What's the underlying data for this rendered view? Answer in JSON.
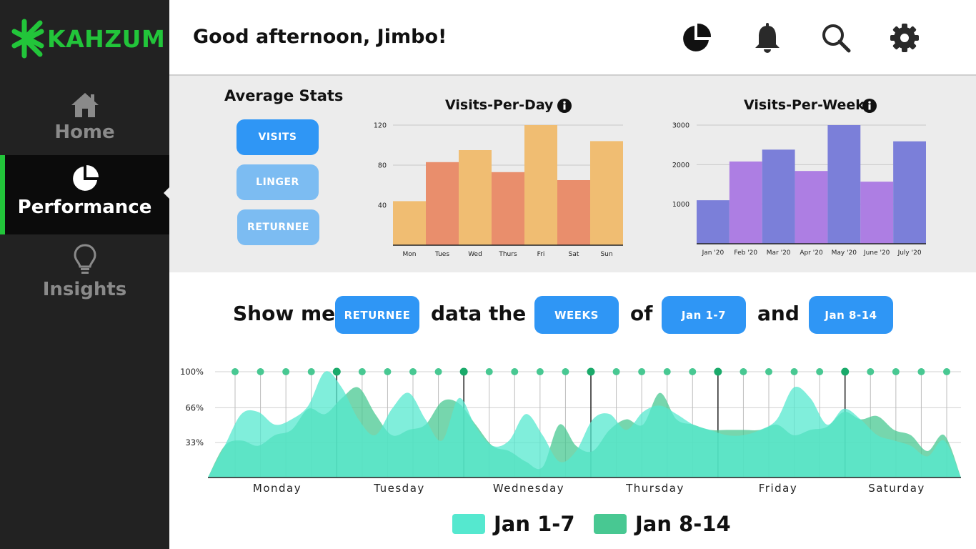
{
  "app": {
    "name": "KAHZUM"
  },
  "sidebar": {
    "items": [
      {
        "label": "Home",
        "icon": "home-icon",
        "active": false
      },
      {
        "label": "Performance",
        "icon": "pie-chart-icon",
        "active": true
      },
      {
        "label": "Insights",
        "icon": "lightbulb-icon",
        "active": false
      }
    ]
  },
  "header": {
    "greeting": "Good afternoon, Jimbo!",
    "icons": [
      "pie-chart-icon",
      "bell-icon",
      "search-icon",
      "gear-icon"
    ]
  },
  "stats": {
    "title": "Average Stats",
    "buttons": [
      {
        "label": "VISITS",
        "active": true
      },
      {
        "label": "LINGER",
        "active": false
      },
      {
        "label": "RETURNEE",
        "active": false
      }
    ]
  },
  "query": {
    "prefix": "Show me",
    "metric": "RETURNEE",
    "middle": "data the",
    "period": "WEEKS",
    "of": "of",
    "range_a": "Jan 1-7",
    "and": "and",
    "range_b": "Jan 8-14"
  },
  "colors": {
    "brand": "#22c53a",
    "accent": "#2f96f5",
    "accent_light": "#7cbcf2",
    "day_a": "#f0bd72",
    "day_b": "#e98e6c",
    "week_a": "#7b7fd9",
    "week_b": "#ad7ee3",
    "series_a": "#55e8cf",
    "series_b": "#48c892"
  },
  "chart_data": [
    {
      "type": "bar",
      "title": "Visits-Per-Day",
      "categories": [
        "Mon",
        "Tues",
        "Wed",
        "Thurs",
        "Fri",
        "Sat",
        "Sun"
      ],
      "values": [
        44,
        83,
        95,
        73,
        120,
        65,
        104
      ],
      "yticks": [
        40,
        80,
        120
      ],
      "ylim": [
        0,
        120
      ],
      "grid": true
    },
    {
      "type": "bar",
      "title": "Visits-Per-Week",
      "categories": [
        "Jan '20",
        "Feb '20",
        "Mar '20",
        "Apr '20",
        "May '20",
        "June '20",
        "July '20"
      ],
      "values": [
        1100,
        2080,
        2380,
        1840,
        3000,
        1570,
        2590
      ],
      "yticks": [
        1000,
        2000,
        3000
      ],
      "ylim": [
        0,
        3000
      ],
      "grid": true
    },
    {
      "type": "area",
      "categories": [
        "Monday",
        "Tuesday",
        "Wednesday",
        "Thursday",
        "Friday",
        "Saturday"
      ],
      "yticks": [
        "33%",
        "66%",
        "100%"
      ],
      "ylim": [
        0,
        100
      ],
      "legend": "bottom",
      "series": [
        {
          "name": "Jan 1-7",
          "values": [
            0,
            30,
            60,
            62,
            50,
            55,
            68,
            100,
            85,
            55,
            40,
            65,
            80,
            55,
            35,
            75,
            48,
            30,
            35,
            60,
            40,
            15,
            25,
            55,
            60,
            45,
            62,
            68,
            60,
            50,
            45,
            40,
            40,
            45,
            55,
            85,
            75,
            50,
            65,
            55,
            40,
            35,
            30,
            20,
            35,
            0
          ]
        },
        {
          "name": "Jan 8-14",
          "values": [
            0,
            30,
            35,
            30,
            40,
            45,
            65,
            60,
            75,
            85,
            60,
            40,
            45,
            50,
            72,
            70,
            50,
            30,
            25,
            15,
            10,
            50,
            30,
            25,
            45,
            55,
            50,
            80,
            55,
            50,
            45,
            45,
            45,
            45,
            50,
            40,
            45,
            48,
            62,
            55,
            58,
            45,
            40,
            25,
            40,
            0
          ]
        }
      ]
    }
  ]
}
